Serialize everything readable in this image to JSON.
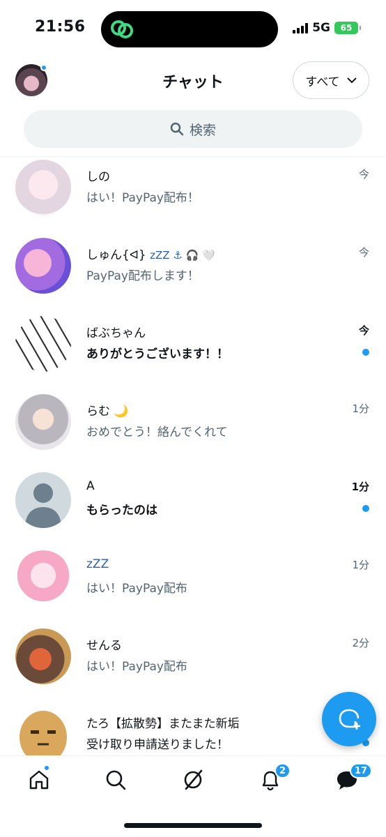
{
  "status_bar": {
    "time": "21:56",
    "network": "5G",
    "battery": "65"
  },
  "header": {
    "title": "チャット",
    "filter_label": "すべて"
  },
  "search": {
    "placeholder": "検索"
  },
  "conversations": [
    {
      "name": "しの",
      "preview": "はい！PayPay配布！",
      "time": "今",
      "unread": false
    },
    {
      "name": "しゅん{ᐊ}",
      "name_suffix": "zZZ ⚓ 🎧 🤍",
      "preview": "PayPay配布します！",
      "time": "今",
      "unread": false
    },
    {
      "name": "ばぶちゃん",
      "preview": "ありがとうございます！！",
      "time": "今",
      "unread": true
    },
    {
      "name": "らむ",
      "name_suffix": "🌙",
      "preview": "おめでとう！絡んでくれて",
      "time": "1分",
      "unread": false
    },
    {
      "name": "A",
      "preview": "もらったのは",
      "time": "1分",
      "unread": true
    },
    {
      "name": "zZZ",
      "preview": "はい！PayPay配布",
      "time": "1分",
      "unread": false
    },
    {
      "name": "せんる",
      "preview": "はい！PayPay配布",
      "time": "2分",
      "unread": false
    },
    {
      "name": "たろ【拡散勢】またまた新垢",
      "preview": "受け取り申請送りました！",
      "time": "",
      "unread": true
    }
  ],
  "tabbar": {
    "items": [
      {
        "name": "home",
        "icon": "home-icon"
      },
      {
        "name": "search",
        "icon": "search-icon"
      },
      {
        "name": "grok",
        "icon": "slash-circle-icon"
      },
      {
        "name": "notifications",
        "icon": "bell-icon",
        "badge": "2"
      },
      {
        "name": "messages",
        "icon": "envelope-icon",
        "badge": "17"
      }
    ]
  },
  "colors": {
    "accent": "#1d9bf0",
    "text": "#0f1419",
    "muted": "#536471",
    "search_bg": "#eff3f4"
  }
}
